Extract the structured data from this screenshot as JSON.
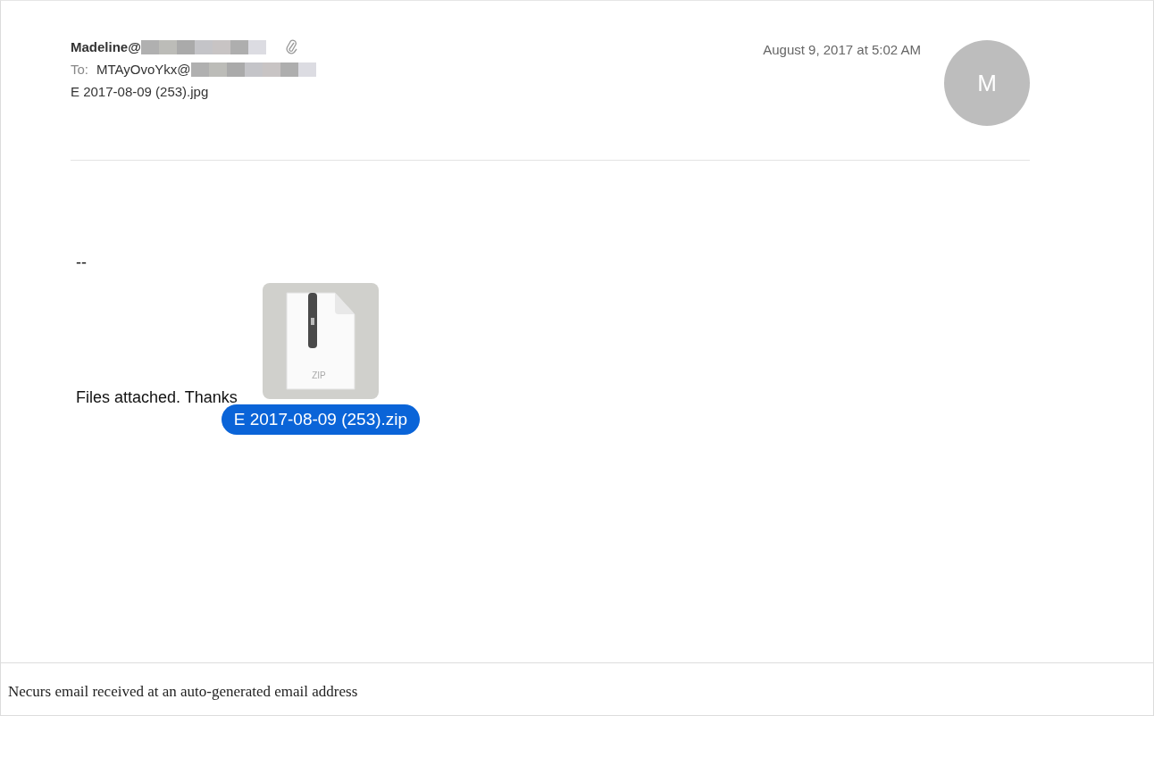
{
  "email": {
    "sender": "Madeline@",
    "sender_redacted": true,
    "has_attachment": true,
    "to_label": "To:",
    "recipient": "MTAyOvoYkx@",
    "recipient_redacted": true,
    "subject": "E 2017-08-09 (253).jpg",
    "date": "August 9, 2017 at 5:02 AM",
    "avatar_initial": "M"
  },
  "body": {
    "signature": "--",
    "text": "Files attached. Thanks",
    "attachment": {
      "type_label": "ZIP",
      "filename": "E 2017-08-09 (253).zip",
      "selected": true
    }
  },
  "caption": "Necurs email received at an auto-generated email address"
}
